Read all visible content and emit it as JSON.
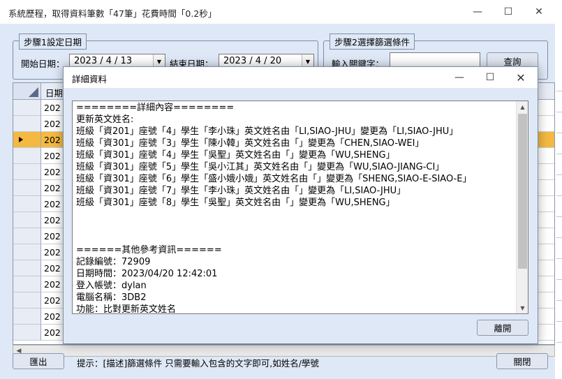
{
  "window": {
    "title": "系統歷程，取得資料筆數「47筆」花費時間「0.2秒」",
    "minimize_icon": "minimize-icon",
    "maximize_icon": "maximize-icon",
    "close_icon": "close-icon"
  },
  "step1": {
    "legend": "步驟1設定日期",
    "start_label": "開始日期：",
    "start_value": "2023 / 4 / 13",
    "end_label": "結束日期：",
    "end_value": "2023 / 4 / 20"
  },
  "step2": {
    "legend": "步驟2選擇篩選條件",
    "keyword_label": "輸入關鍵字：",
    "keyword_value": "",
    "query_button": "查詢"
  },
  "grid": {
    "header": "日期",
    "rows": [
      "202",
      "202",
      "202",
      "202",
      "202",
      "202",
      "202",
      "202",
      "202",
      "202",
      "202",
      "202",
      "202",
      "202",
      "202"
    ],
    "selected_row": 2
  },
  "footer": {
    "export_button": "匯出",
    "hint": "提示：[描述]篩選條件 只需要輸入包含的文字即可,如姓名/學號",
    "close_button": "關閉"
  },
  "dialog": {
    "title": "詳細資料",
    "lines": [
      "========詳細內容========",
      "更新英文姓名:",
      "班級「資201」座號「4」學生「李小珠」英文姓名由「LI,SIAO-JHU」變更為「LI,SIAO-JHU」",
      "班級「資301」座號「3」學生「陳小韓」英文姓名由「」變更為「CHEN,SIAO-WEI」",
      "班級「資301」座號「4」學生「吳聖」英文姓名由「」變更為「WU,SHENG」",
      "班級「資301」座號「5」學生「吳小江其」英文姓名由「」變更為「WU,SIAO-JIANG-CI」",
      "班級「資301」座號「6」學生「盛小娥小娥」英文姓名由「」變更為「SHENG,SIAO-E-SIAO-E」",
      "班級「資301」座號「7」學生「李小珠」英文姓名由「」變更為「LI,SIAO-JHU」",
      "班級「資301」座號「8」學生「吳聖」英文姓名由「」變更為「WU,SHENG」",
      "",
      "",
      "",
      "======其他參考資訊======",
      "記錄編號：72909",
      "日期時間：2023/04/20 12:42:01",
      "登入帳號：dylan",
      "電腦名稱：3DB2",
      "功能：比對更新英文姓名"
    ],
    "leave_button": "離開"
  }
}
